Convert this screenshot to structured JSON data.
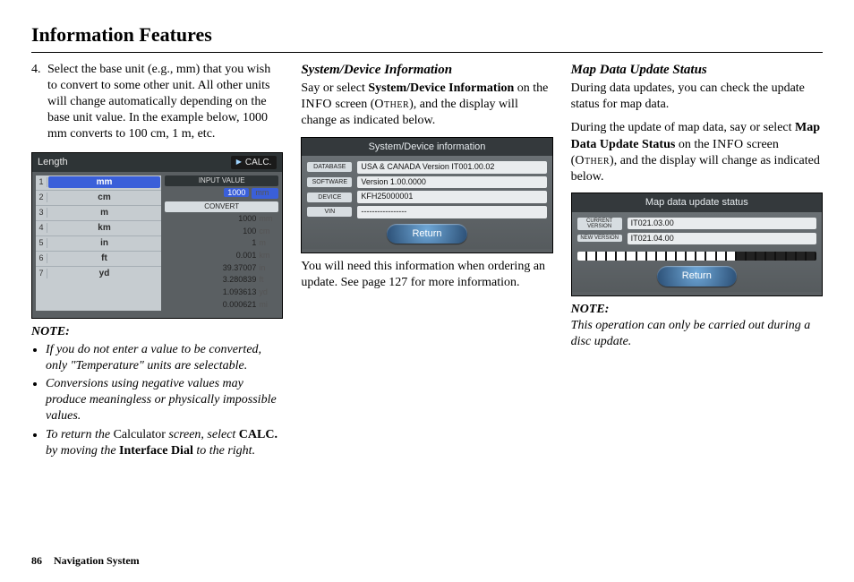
{
  "page_title": "Information Features",
  "footer": {
    "page": "86",
    "section": "Navigation System"
  },
  "col1": {
    "step_num": "4.",
    "step_text": "Select the base unit (e.g., mm) that you wish to convert to some other unit. All other units will change automatically depending on the base unit value. In the example below, 1000 mm converts to 100 cm, 1 m, etc.",
    "device": {
      "title": "Length",
      "calc": "CALC.",
      "units": [
        {
          "idx": "1",
          "label": "mm",
          "hl": true
        },
        {
          "idx": "2",
          "label": "cm"
        },
        {
          "idx": "3",
          "label": "m"
        },
        {
          "idx": "4",
          "label": "km"
        },
        {
          "idx": "5",
          "label": "in"
        },
        {
          "idx": "6",
          "label": "ft"
        },
        {
          "idx": "7",
          "label": "yd"
        }
      ],
      "input_label": "INPUT VALUE",
      "input_value": "1000",
      "input_unit": "mm",
      "convert": "CONVERT",
      "rows": [
        {
          "v": "1000",
          "u": "mm"
        },
        {
          "v": "100",
          "u": "cm"
        },
        {
          "v": "1",
          "u": "m"
        },
        {
          "v": "0.001",
          "u": "km"
        },
        {
          "v": "39.37007",
          "u": "in"
        },
        {
          "v": "3.280839",
          "u": "ft"
        },
        {
          "v": "1.093613",
          "u": "yd"
        },
        {
          "v": "0.000621",
          "u": "mi"
        }
      ]
    },
    "note_head": "NOTE:",
    "note1_a": "If you do not enter a value to be converted, only \"Temperature\" units are selectable.",
    "note2_a": "Conversions using negative values may produce meaningless or physically impossible values.",
    "note3_a": "To return the ",
    "note3_b": "Calculator",
    "note3_c": " screen, select ",
    "note3_d": "CALC.",
    "note3_e": " by moving the ",
    "note3_f": "Interface Dial",
    "note3_g": " to the right."
  },
  "col2": {
    "heading": "System/Device Information",
    "p1_a": "Say or select ",
    "p1_b": "System/Device Information",
    "p1_c": " on the ",
    "p1_d": "INFO",
    "p1_e": " screen (",
    "p1_f": "Other",
    "p1_g": "), and the display will change as indicated below.",
    "device": {
      "title": "System/Device information",
      "rows": [
        {
          "tag": "DATABASE",
          "val": "USA & CANADA Version IT001.00.02"
        },
        {
          "tag": "SOFTWARE",
          "val": "Version 1.00.0000"
        },
        {
          "tag": "DEVICE",
          "val": "KFH25000001"
        },
        {
          "tag": "VIN",
          "val": "-----------------"
        }
      ],
      "return": "Return"
    },
    "p2": "You will need this information when ordering an update. See page 127 for more information."
  },
  "col3": {
    "heading": "Map Data Update Status",
    "p1": "During data updates, you can check the update status for map data.",
    "p2_a": "During the update of map data, say or select ",
    "p2_b": "Map Data Update Status",
    "p2_c": " on the ",
    "p2_d": "INFO",
    "p2_e": " screen (",
    "p2_f": "Other",
    "p2_g": "), and the display will change as indicated below.",
    "device": {
      "title": "Map data update status",
      "cur_tag": "CURRENT VERSION",
      "cur_val": "IT021.03.00",
      "new_tag": "NEW VERSION",
      "new_val": "IT021.04.00",
      "return": "Return"
    },
    "note_head": "NOTE:",
    "note": "This operation can only be carried out during a disc update."
  }
}
